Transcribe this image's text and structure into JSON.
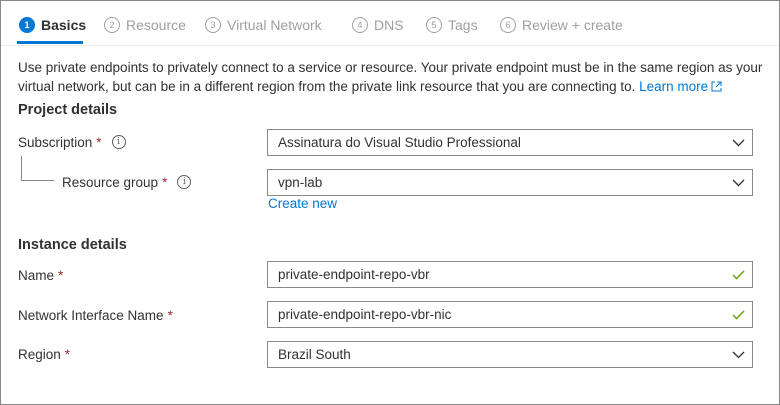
{
  "tabs": [
    {
      "num": "1",
      "label": "Basics"
    },
    {
      "num": "2",
      "label": "Resource"
    },
    {
      "num": "3",
      "label": "Virtual Network"
    },
    {
      "num": "4",
      "label": "DNS"
    },
    {
      "num": "5",
      "label": "Tags"
    },
    {
      "num": "6",
      "label": "Review + create"
    }
  ],
  "intro": {
    "text": "Use private endpoints to privately connect to a service or resource. Your private endpoint must be in the same region as your virtual network, but can be in a different region from the private link resource that you are connecting to.",
    "learn_more": "Learn more"
  },
  "project": {
    "title": "Project details",
    "subscription_label": "Subscription",
    "subscription_value": "Assinatura do Visual Studio Professional",
    "rg_label": "Resource group",
    "rg_value": "vpn-lab",
    "create_new": "Create new"
  },
  "instance": {
    "title": "Instance details",
    "name_label": "Name",
    "name_value": "private-endpoint-repo-vbr",
    "nic_label": "Network Interface Name",
    "nic_value": "private-endpoint-repo-vbr-nic",
    "region_label": "Region",
    "region_value": "Brazil South"
  },
  "required_mark": "*",
  "info_glyph": "i",
  "colors": {
    "accent": "#0078d4",
    "required": "#a4262c",
    "valid": "#57a300"
  }
}
